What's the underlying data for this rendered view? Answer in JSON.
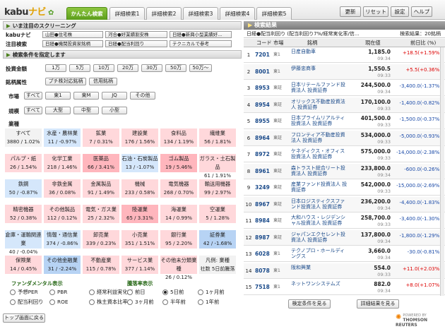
{
  "app": {
    "logo_a": "kabu",
    "logo_b": "ナビ"
  },
  "tabs": [
    "かんたん検索",
    "詳細検索1",
    "詳細検索2",
    "詳細検索3",
    "詳細検索4",
    "詳細検索5"
  ],
  "toolbar": {
    "update": "更新",
    "reset": "リセット",
    "settings": "設定",
    "help": "ヘルプ"
  },
  "left": {
    "trend_header": "いま注目のスクリーニング",
    "kabunavi_label": "kabuナビ",
    "kabunavi_items": [
      "山田●住宅株",
      "河合●好業績割安株",
      "日経●新興小型業績好..."
    ],
    "focus_label": "注目検索",
    "focus_items": [
      "日経●機関投資家銘柄",
      "日経●配当利回り",
      "テクニカルで参考"
    ],
    "cond_header": "検索条件を指定します",
    "volume_label": "投資金額",
    "volume_opts": [
      "1万",
      "5万",
      "10万",
      "20万",
      "30万",
      "50万",
      "50万～"
    ],
    "attr_label": "銘柄属性",
    "attr_opts": [
      "プチ株対応銘柄",
      "信用銘柄"
    ],
    "market_label": "市場",
    "market_opts": [
      "すべて",
      "東1",
      "東M",
      "JQ",
      "その他"
    ],
    "scale_label": "規模",
    "scale_opts": [
      "すべて",
      "大型",
      "中型",
      "小型"
    ],
    "industry_label": "業種",
    "industries": [
      {
        "n": "すべて",
        "v": "3880 /  1.02%",
        "c": "w"
      },
      {
        "n": "水産・農林業",
        "v": "11 / -0.97%",
        "c": "b1"
      },
      {
        "n": "鉱業",
        "v": "7 /  0.31%",
        "c": "r1"
      },
      {
        "n": "建設業",
        "v": "176 / 1.56%",
        "c": "r1"
      },
      {
        "n": "食料品",
        "v": "134 / 1.19%",
        "c": "r1"
      },
      {
        "n": "繊維業",
        "v": "56 / 1.81%",
        "c": "r1"
      },
      {
        "n": "パルプ・紙",
        "v": "26 / 1.54%",
        "c": "r1"
      },
      {
        "n": "化学工業",
        "v": "218 / 1.46%",
        "c": "r1"
      },
      {
        "n": "医薬品",
        "v": "66 / 3.41%",
        "c": "r2"
      },
      {
        "n": "石油・石炭製品",
        "v": "13 / -1.07%",
        "c": "b1"
      },
      {
        "n": "ゴム製品",
        "v": "19 / 5.46%",
        "c": "r2"
      },
      {
        "n": "ガラス・土石製品",
        "v": "61 / 1.91%",
        "c": "r1"
      },
      {
        "n": "鉄鋼",
        "v": "50 / -0.87%",
        "c": "b1"
      },
      {
        "n": "非鉄金属",
        "v": "36 / 0.08%",
        "c": "r1"
      },
      {
        "n": "金属製品",
        "v": "91 / 1.49%",
        "c": "r1"
      },
      {
        "n": "機械",
        "v": "233 / 0.58%",
        "c": "r1"
      },
      {
        "n": "電気機器",
        "v": "268 / 0.70%",
        "c": "r1"
      },
      {
        "n": "輸送用機器",
        "v": "99 / 2.97%",
        "c": "r1"
      },
      {
        "n": "精密機器",
        "v": "52 / 0.38%",
        "c": "r1"
      },
      {
        "n": "その他製品",
        "v": "112 / 0.12%",
        "c": "r1"
      },
      {
        "n": "電気・ガス業",
        "v": "25 / 2.32%",
        "c": "r1"
      },
      {
        "n": "陸運業",
        "v": "65 / 3.31%",
        "c": "r2"
      },
      {
        "n": "海運業",
        "v": "14 / 0.99%",
        "c": "r1"
      },
      {
        "n": "空運業",
        "v": "5 / 1.28%",
        "c": "r1"
      },
      {
        "n": "倉庫・運輸関連業",
        "v": "40 / -0.04%",
        "c": "b1"
      },
      {
        "n": "情報・通信業",
        "v": "374 / -0.86%",
        "c": "b1"
      },
      {
        "n": "卸売業",
        "v": "339 / 0.23%",
        "c": "r1"
      },
      {
        "n": "小売業",
        "v": "351 / 1.51%",
        "c": "r1"
      },
      {
        "n": "銀行業",
        "v": "95 / 2.20%",
        "c": "r1"
      },
      {
        "n": "証券業",
        "v": "42 / -1.68%",
        "c": "b2"
      },
      {
        "n": "保険業",
        "v": "14 / 0.45%",
        "c": "r1"
      },
      {
        "n": "その他金融業",
        "v": "31 / -2.24%",
        "c": "b2"
      },
      {
        "n": "不動産業",
        "v": "115 / 0.78%",
        "c": "r1"
      },
      {
        "n": "サービス業",
        "v": "377 / 1.14%",
        "c": "r1"
      },
      {
        "n": "その他未分類業種",
        "v": "26 / 0.12%",
        "c": "r1"
      },
      {
        "n": "凡例: 業種",
        "v": "社数 5日前騰落",
        "c": "w"
      }
    ],
    "fund_label": "ファンダメンタル表示",
    "fund_opts": [
      {
        "t": "予想PER",
        "on": false
      },
      {
        "t": "PBR",
        "on": false
      },
      {
        "t": "経常利益実化率",
        "on": false
      },
      {
        "t": "配当利回り",
        "on": false
      },
      {
        "t": "ROE",
        "on": false
      },
      {
        "t": "株主資本比率",
        "on": false
      }
    ],
    "period_label": "騰落率表示",
    "period_opts": [
      {
        "t": "前日",
        "on": false
      },
      {
        "t": "5日前",
        "on": true
      },
      {
        "t": "1ヶ月前",
        "on": false
      },
      {
        "t": "3ヶ月前",
        "on": false
      },
      {
        "t": "半年前",
        "on": false
      },
      {
        "t": "1年前",
        "on": false
      }
    ],
    "back_btn": "トップ画面に戻る"
  },
  "right": {
    "header": "検索結果",
    "summary": "日経●配当利回り (配当利回り7%/経常実化率/信...",
    "count": "検索結果：20銘柄",
    "cols": [
      "",
      "コード",
      "市場",
      "銘柄",
      "現在値",
      "前日比 (%)"
    ],
    "rows": [
      {
        "no": "1",
        "code": "7201",
        "mkt": "東1",
        "name": "日産自動車",
        "price": "1,185.0",
        "time": "09:34",
        "chg": "+18.5(+1.59%)",
        "dir": "up"
      },
      {
        "no": "2",
        "code": "8001",
        "mkt": "東1",
        "name": "伊藤忠商事",
        "price": "1,550.5",
        "time": "09:33",
        "chg": "+5.5(+0.36%)",
        "dir": "up"
      },
      {
        "no": "3",
        "code": "8953",
        "mkt": "東証",
        "name": "日本リテールファンド投資法人 投資証券",
        "price": "244,500.0",
        "time": "09:34",
        "chg": "-3,400.0(-1.37%)",
        "dir": "dn"
      },
      {
        "no": "4",
        "code": "8954",
        "mkt": "東証",
        "name": "オリックス不動産投資法人 投資証券",
        "price": "170,100.0",
        "time": "09:33",
        "chg": "-1,400.0(-0.82%)",
        "dir": "dn"
      },
      {
        "no": "5",
        "code": "8955",
        "mkt": "東証",
        "name": "日本プライムリアルティ投資法人 投資証券",
        "price": "401,500.0",
        "time": "09:33",
        "chg": "-1,500.0(-0.37%)",
        "dir": "dn"
      },
      {
        "no": "6",
        "code": "8964",
        "mkt": "東証",
        "name": "フロンティア不動産投資法人 投資証券",
        "price": "534,000.0",
        "time": "09:33",
        "chg": "-5,000.0(-0.93%)",
        "dir": "dn"
      },
      {
        "no": "7",
        "code": "8972",
        "mkt": "東証",
        "name": "ケネディクス・オフィス投資法人 投資証券",
        "price": "575,000.0",
        "time": "09:33",
        "chg": "-14,000.0(-2.38%)",
        "dir": "dn"
      },
      {
        "no": "8",
        "code": "8961",
        "mkt": "東証",
        "name": "森トラスト総合リート投資法人 投資証券",
        "price": "233,800.0",
        "time": "09:34",
        "chg": "-600.0(-0.26%)",
        "dir": "dn"
      },
      {
        "no": "9",
        "code": "3249",
        "mkt": "東証",
        "name": "産業ファンド投資法人 投資証券",
        "price": "542,000.0",
        "time": "09:33",
        "chg": "-15,000.0(-2.69%)",
        "dir": "dn"
      },
      {
        "no": "10",
        "code": "8967",
        "mkt": "東証",
        "name": "日本ロジスティクスファンド投資法人 投資証券",
        "price": "236,200.0",
        "time": "09:34",
        "chg": "-4,400.0(-1.83%)",
        "dir": "dn"
      },
      {
        "no": "11",
        "code": "8984",
        "mkt": "東証",
        "name": "大和ハウス・レジデンシャル投資法人 投資証券",
        "price": "258,700.0",
        "time": "09:33",
        "chg": "-3,400.0(-1.30%)",
        "dir": "dn"
      },
      {
        "no": "12",
        "code": "8987",
        "mkt": "東証",
        "name": "ジャパンエクセレント投資法人 投資証券",
        "price": "137,800.0",
        "time": "09:34",
        "chg": "-1,800.0(-1.29%)",
        "dir": "dn"
      },
      {
        "no": "13",
        "code": "6028",
        "mkt": "東1",
        "name": "テクノプロ・ホールディングス",
        "price": "3,660.0",
        "time": "09:34",
        "chg": "-30.0(-0.81%)",
        "dir": "dn"
      },
      {
        "no": "14",
        "code": "8078",
        "mkt": "東1",
        "name": "阪和興業",
        "price": "554.0",
        "time": "09:33",
        "chg": "+11.0(+2.03%)",
        "dir": "up"
      },
      {
        "no": "15",
        "code": "7518",
        "mkt": "東1",
        "name": "ネットワンシステムズ",
        "price": "882.0",
        "time": "09:34",
        "chg": "+8.0(+1.07%)",
        "dir": "up"
      }
    ],
    "save_btn": "検定条件を見る",
    "detail_btn": "詳細結果を見る",
    "powered": "POWERED BY",
    "brand": "THOMSON REUTERS"
  }
}
